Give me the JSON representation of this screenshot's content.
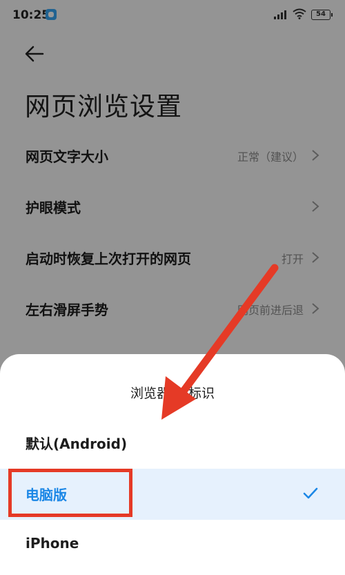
{
  "status_bar": {
    "time": "10:25",
    "battery": "54",
    "icons": [
      "app-icon",
      "signal-icon",
      "wifi-icon",
      "battery-icon"
    ]
  },
  "page": {
    "title": "网页浏览设置",
    "back_icon": "arrow-left-icon"
  },
  "settings": [
    {
      "label": "网页文字大小",
      "value": "正常（建议）"
    },
    {
      "label": "护眼模式",
      "value": ""
    },
    {
      "label": "启动时恢复上次打开的网页",
      "value": "打开"
    },
    {
      "label": "左右滑屏手势",
      "value": "网页前进后退"
    }
  ],
  "sheet": {
    "title": "浏览器UA标识",
    "options": [
      {
        "label": "默认(Android)",
        "selected": false
      },
      {
        "label": "电脑版",
        "selected": true
      },
      {
        "label": "iPhone",
        "selected": false
      }
    ]
  },
  "colors": {
    "accent": "#1b87e6",
    "selected_bg": "#e6f1fd",
    "annotation_red": "#e53a26"
  }
}
